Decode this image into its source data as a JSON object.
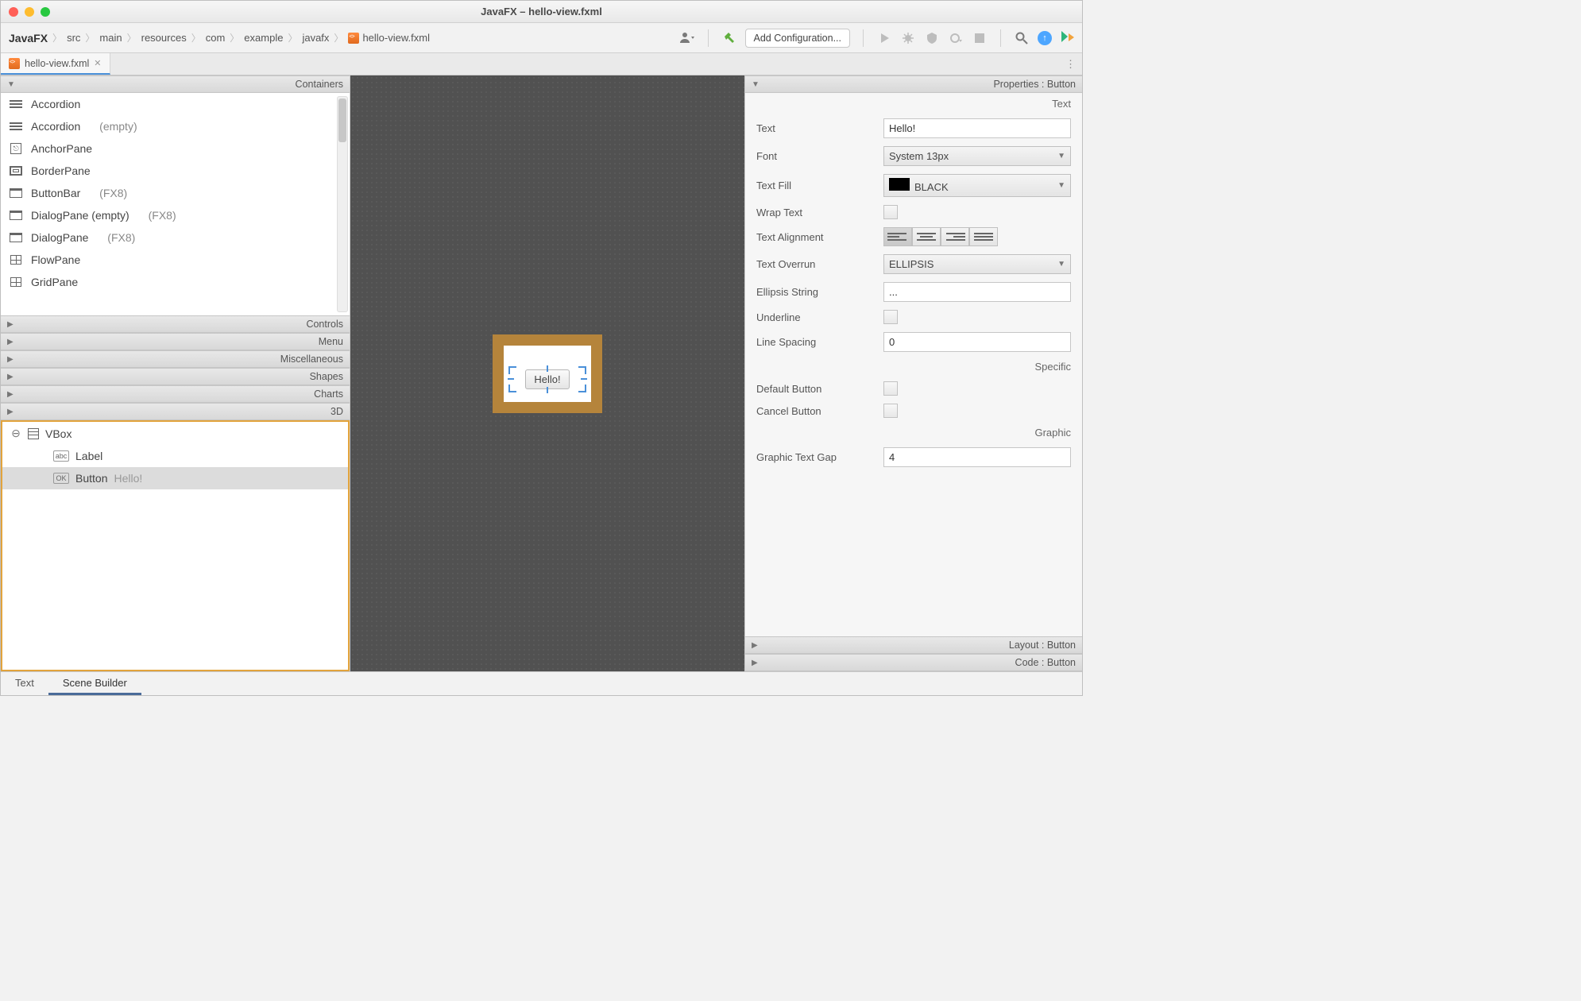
{
  "window": {
    "title": "JavaFX – hello-view.fxml"
  },
  "breadcrumb": [
    "JavaFX",
    "src",
    "main",
    "resources",
    "com",
    "example",
    "javafx",
    "hello-view.fxml"
  ],
  "toolbar": {
    "addConfig": "Add Configuration..."
  },
  "tabs": {
    "file": "hello-view.fxml"
  },
  "leftPanel": {
    "sections": {
      "containers": "Containers",
      "controls": "Controls",
      "menu": "Menu",
      "misc": "Miscellaneous",
      "shapes": "Shapes",
      "charts": "Charts",
      "threeD": "3D"
    },
    "containers": [
      {
        "name": "Accordion"
      },
      {
        "name": "Accordion",
        "ann": "(empty)"
      },
      {
        "name": "AnchorPane"
      },
      {
        "name": "BorderPane"
      },
      {
        "name": "ButtonBar",
        "ann": "(FX8)"
      },
      {
        "name": "DialogPane (empty)",
        "ann": "(FX8)"
      },
      {
        "name": "DialogPane",
        "ann": "(FX8)"
      },
      {
        "name": "FlowPane"
      },
      {
        "name": "GridPane"
      }
    ]
  },
  "hierarchy": {
    "root": "VBox",
    "label": "Label",
    "button": "Button",
    "buttonText": "Hello!"
  },
  "canvas": {
    "buttonText": "Hello!"
  },
  "rightPanel": {
    "header": "Properties : Button",
    "sections": {
      "text": "Text",
      "specific": "Specific",
      "graphic": "Graphic"
    },
    "labels": {
      "text": "Text",
      "font": "Font",
      "textFill": "Text Fill",
      "wrapText": "Wrap Text",
      "textAlign": "Text Alignment",
      "overrun": "Text Overrun",
      "ellipsis": "Ellipsis String",
      "underline": "Underline",
      "lineSpacing": "Line Spacing",
      "defaultBtn": "Default Button",
      "cancelBtn": "Cancel Button",
      "graphicGap": "Graphic Text Gap"
    },
    "values": {
      "text": "Hello!",
      "font": "System 13px",
      "textFill": "BLACK",
      "overrun": "ELLIPSIS",
      "ellipsis": "...",
      "lineSpacing": "0",
      "graphicGap": "4"
    },
    "footers": {
      "layout": "Layout : Button",
      "code": "Code : Button"
    }
  },
  "bottomTabs": {
    "text": "Text",
    "sceneBuilder": "Scene Builder"
  }
}
